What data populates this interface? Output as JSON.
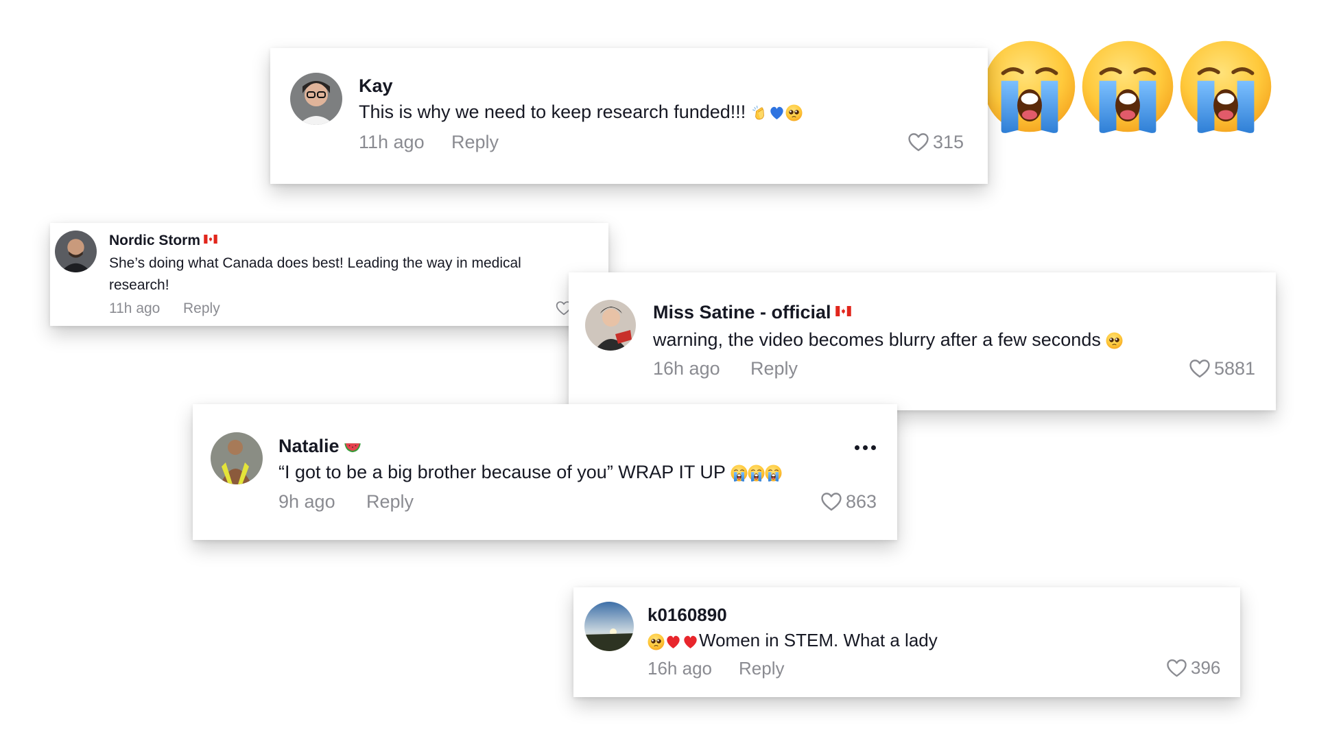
{
  "comments": [
    {
      "username": "Kay",
      "text": "This is why we need to keep research funded!!!",
      "emojis": [
        "clapping-hands",
        "blue-heart",
        "pleading-face"
      ],
      "time": "11h ago",
      "reply_label": "Reply",
      "likes": "315"
    },
    {
      "username": "Nordic Storm",
      "flag": "canada-flag",
      "text_line1": "She’s doing what Canada does best! Leading the way in medical",
      "text_line2": "research!",
      "time": "11h ago",
      "reply_label": "Reply"
    },
    {
      "username": "Miss Satine - official",
      "flag": "canada-flag",
      "text": "warning, the video becomes blurry after a few seconds",
      "emojis": [
        "pleading-face"
      ],
      "time": "16h ago",
      "reply_label": "Reply",
      "likes": "5881"
    },
    {
      "username": "Natalie",
      "badge_emoji": "watermelon",
      "text": "“I got to be a big brother because of you” WRAP IT UP",
      "emojis": [
        "loudly-crying-face",
        "loudly-crying-face",
        "loudly-crying-face"
      ],
      "time": "9h ago",
      "reply_label": "Reply",
      "likes": "863"
    },
    {
      "username": "k0160890",
      "emojis_before": [
        "pleading-face",
        "red-heart",
        "red-heart"
      ],
      "text": "Women in STEM. What a lady",
      "time": "16h ago",
      "reply_label": "Reply",
      "likes": "396"
    }
  ],
  "decoration": {
    "large_emojis": [
      "loudly-crying-face",
      "loudly-crying-face",
      "loudly-crying-face"
    ]
  },
  "colors": {
    "text": "#161823",
    "muted": "#8a8b91",
    "emoji_yellow": "#FFC93B",
    "tear_blue": "#3D8FE0",
    "canada_red": "#E1261C"
  }
}
